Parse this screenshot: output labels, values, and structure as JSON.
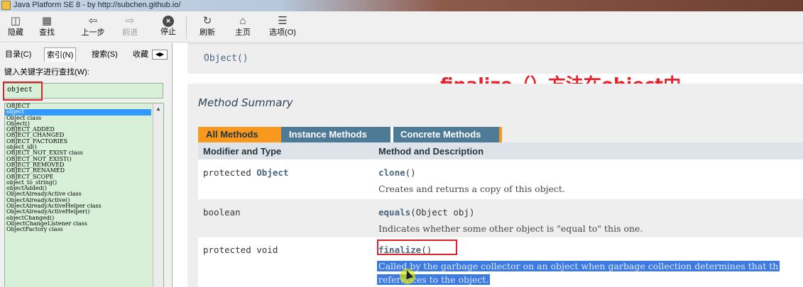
{
  "window": {
    "title": "Java Platform SE 8 - by http://subchen.github.io/"
  },
  "toolbar": {
    "items": [
      {
        "label": "隐藏",
        "icon": "hide-icon",
        "enabled": true
      },
      {
        "label": "查找",
        "icon": "locate-icon",
        "enabled": true
      },
      {
        "label": "上一步",
        "icon": "back-arrow-icon",
        "enabled": true
      },
      {
        "label": "前进",
        "icon": "forward-arrow-icon",
        "enabled": false
      },
      {
        "label": "停止",
        "icon": "stop-icon",
        "enabled": true
      },
      {
        "label": "刷新",
        "icon": "refresh-icon",
        "enabled": true
      },
      {
        "label": "主页",
        "icon": "home-icon",
        "enabled": true
      },
      {
        "label": "选项(O)",
        "icon": "options-icon",
        "enabled": true
      }
    ]
  },
  "sidebar": {
    "tabs": [
      {
        "label": "目录(C)"
      },
      {
        "label": "索引(N)"
      },
      {
        "label": "搜索(S)"
      },
      {
        "label": "收藏"
      }
    ],
    "keyword_label": "键入关键字进行查找(W):",
    "keyword_value": "object",
    "index_items": [
      "OBJECT",
      "object",
      "Object class",
      "Object()",
      "OBJECT_ADDED",
      "OBJECT_CHANGED",
      "OBJECT_FACTORIES",
      "object_id()",
      "OBJECT_NOT_EXIST class",
      "OBJECT_NOT_EXIST()",
      "OBJECT_REMOVED",
      "OBJECT_RENAMED",
      "OBJECT_SCOPE",
      "object_to_string()",
      "objectAdded()",
      "ObjectAlreadyActive class",
      "ObjectAlreadyActive()",
      "ObjectAlreadyActiveHelper class",
      "ObjectAlreadyActiveHelper()",
      "objectChanged()",
      "ObjectChangeListener class",
      "ObjectFactory class"
    ],
    "selected_index": 1
  },
  "doc": {
    "constructor": "Object()",
    "annotation": "finalize（）方法在object中",
    "summary_title": "Method Summary",
    "method_tabs": [
      {
        "label": "All Methods",
        "active": true
      },
      {
        "label": "Instance Methods",
        "active": false
      },
      {
        "label": "Concrete Methods",
        "active": false
      }
    ],
    "headers": {
      "modifier": "Modifier and Type",
      "method": "Method and Description"
    },
    "rows": [
      {
        "modifier_prefix": "protected ",
        "modifier_type": "Object",
        "method": "clone",
        "params": "()",
        "description": "Creates and returns a copy of this object."
      },
      {
        "modifier_prefix": "boolean",
        "modifier_type": "",
        "method": "equals",
        "params": "(Object obj)",
        "description": "Indicates whether some other object is \"equal to\" this one."
      },
      {
        "modifier_prefix": "protected void",
        "modifier_type": "",
        "method": "finalize",
        "params": "()",
        "description_line1": "Called by the garbage collector on an object when garbage collection determines that th",
        "description_line2": "references to the object."
      }
    ]
  },
  "colors": {
    "tab_active": "#f8981d",
    "tab_inactive": "#4d7a97",
    "annotation_red": "#e8202a",
    "selection_blue": "#3d7be0",
    "index_bg": "#d8f0d8"
  }
}
